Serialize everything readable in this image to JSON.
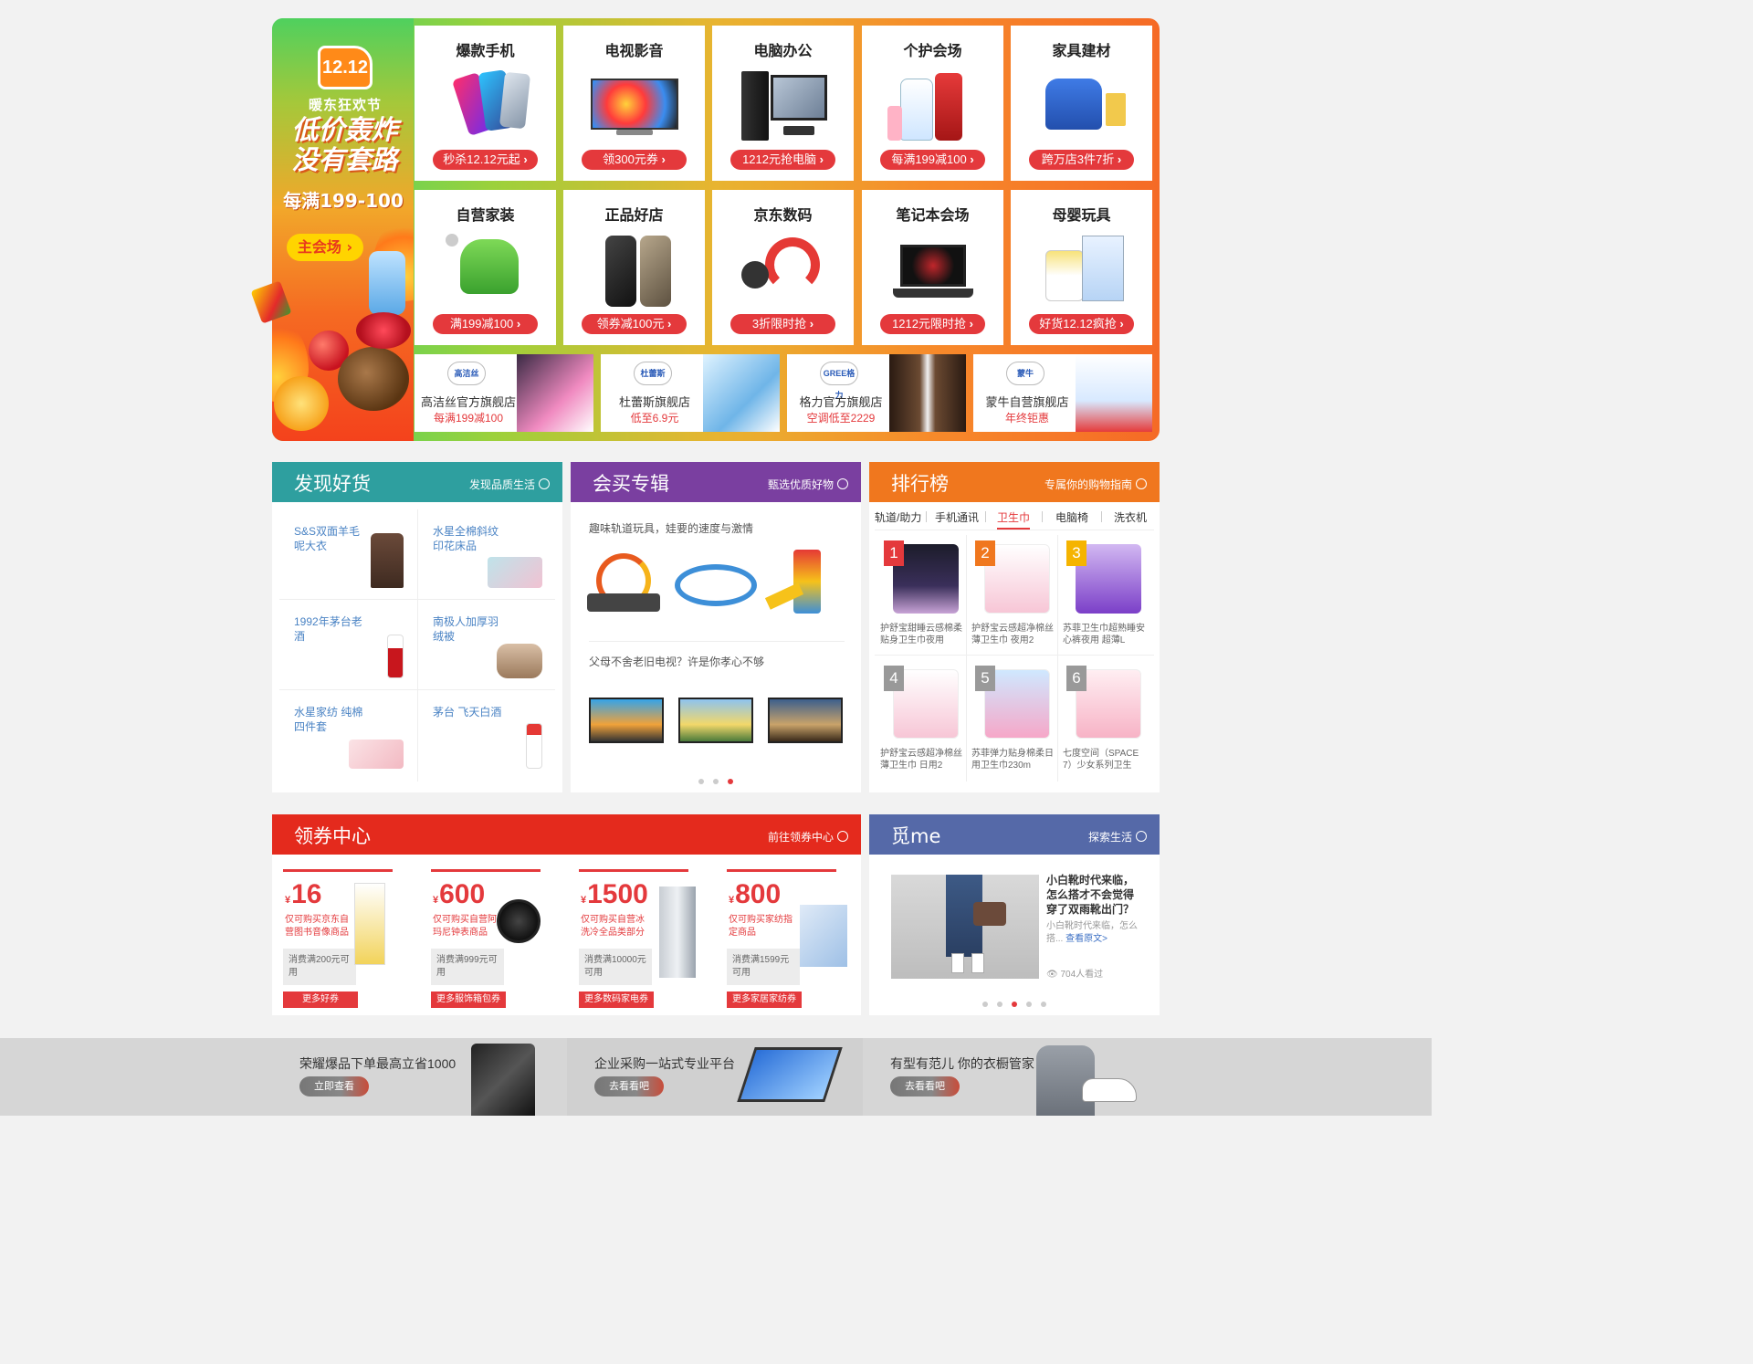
{
  "festival": {
    "badge": "12.12",
    "subtitle": "暖东狂欢节",
    "slogan_line1": "低价轰炸",
    "slogan_line2": "没有套路",
    "deal": "每满199-100",
    "main_button": "主会场 ›",
    "categories": [
      {
        "title": "爆款手机",
        "button": "秒杀12.12元起"
      },
      {
        "title": "电视影音",
        "button": "领300元券"
      },
      {
        "title": "电脑办公",
        "button": "1212元抢电脑"
      },
      {
        "title": "个护会场",
        "button": "每满199减100"
      },
      {
        "title": "家具建材",
        "button": "跨万店3件7折"
      },
      {
        "title": "自营家装",
        "button": "满199减100"
      },
      {
        "title": "正品好店",
        "button": "领券减100元"
      },
      {
        "title": "京东数码",
        "button": "3折限时抢"
      },
      {
        "title": "笔记本会场",
        "button": "1212元限时抢"
      },
      {
        "title": "母婴玩具",
        "button": "好货12.12疯抢"
      }
    ],
    "shops": [
      {
        "logo": "高洁丝",
        "name": "高洁丝官方旗舰店",
        "deal": "每满199减100"
      },
      {
        "logo": "杜蕾斯",
        "name": "杜蕾斯旗舰店",
        "deal": "低至6.9元"
      },
      {
        "logo": "GREE格力",
        "name": "格力官方旗舰店",
        "deal": "空调低至2229"
      },
      {
        "logo": "蒙牛",
        "name": "蒙牛自营旗舰店",
        "deal": "年终钜惠"
      }
    ]
  },
  "discover": {
    "title": "发现好货",
    "link": "发现品质生活",
    "items": [
      {
        "name": "S&S双面羊毛呢大衣"
      },
      {
        "name": "水星全棉斜纹印花床品"
      },
      {
        "name": "1992年茅台老酒"
      },
      {
        "name": "南极人加厚羽绒被"
      },
      {
        "name": "水星家纺 纯棉四件套"
      },
      {
        "name": "茅台 飞天白酒"
      }
    ]
  },
  "album": {
    "title": "会买专辑",
    "link": "甄选优质好物",
    "caption1": "趣味轨道玩具，娃要的速度与激情",
    "caption2": "父母不舍老旧电视？许是你孝心不够"
  },
  "ranking": {
    "title": "排行榜",
    "link": "专属你的购物指南",
    "tabs": [
      "轨道/助力",
      "手机通讯",
      "卫生巾",
      "电脑椅",
      "洗衣机"
    ],
    "active_tab": "卫生巾",
    "items": [
      {
        "rank": "1",
        "name": "护舒宝甜睡云感棉柔贴身卫生巾夜用"
      },
      {
        "rank": "2",
        "name": "护舒宝云感超净棉丝薄卫生巾 夜用2"
      },
      {
        "rank": "3",
        "name": "苏菲卫生巾超熟睡安心裤夜用 超薄L"
      },
      {
        "rank": "4",
        "name": "护舒宝云感超净棉丝薄卫生巾 日用2"
      },
      {
        "rank": "5",
        "name": "苏菲弹力贴身棉柔日用卫生巾230m"
      },
      {
        "rank": "6",
        "name": "七度空间（SPACE 7）少女系列卫生"
      }
    ]
  },
  "coupons": {
    "title": "领券中心",
    "link": "前往领券中心",
    "items": [
      {
        "amount": "16",
        "desc": "仅可购买京东自营图书音像商品",
        "cond": "消费满200元可用",
        "button": "更多好券"
      },
      {
        "amount": "600",
        "desc": "仅可购买自营阿玛尼钟表商品",
        "cond": "消费满999元可用",
        "button": "更多服饰箱包券"
      },
      {
        "amount": "1500",
        "desc": "仅可购买自营冰洗冷全品类部分",
        "cond": "消费满10000元可用",
        "button": "更多数码家电券"
      },
      {
        "amount": "800",
        "desc": "仅可购买家纺指定商品",
        "cond": "消费满1599元可用",
        "button": "更多家居家纺券"
      }
    ]
  },
  "meme": {
    "title": "觅me",
    "link": "探索生活",
    "article_title": "小白靴时代来临，怎么搭才不会觉得穿了双雨靴出门？",
    "article_excerpt": "小白靴时代来临，怎么搭...",
    "read_more": "查看原文>",
    "views": "704人看过"
  },
  "promos": [
    {
      "text": "荣耀爆品下单最高立省1000",
      "button": "立即查看"
    },
    {
      "text": "企业采购一站式专业平台",
      "button": "去看看吧"
    },
    {
      "text": "有型有范儿 你的衣橱管家",
      "button": "去看看吧"
    }
  ]
}
